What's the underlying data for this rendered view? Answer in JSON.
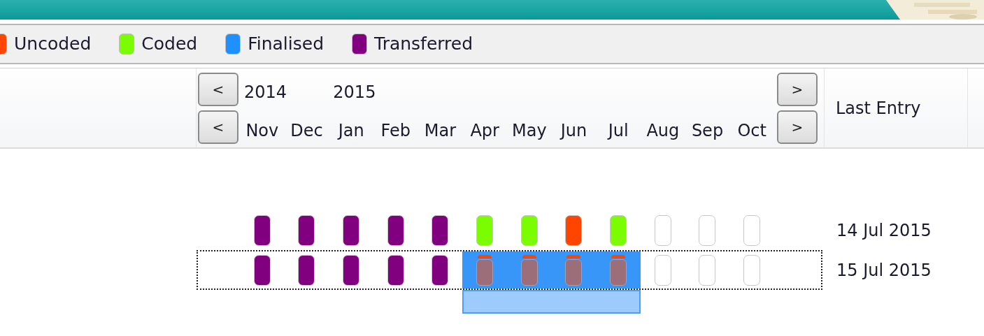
{
  "legend": [
    {
      "label": "Uncoded",
      "color": "#ff4500"
    },
    {
      "label": "Coded",
      "color": "#7cfc00"
    },
    {
      "label": "Finalised",
      "color": "#1e90ff"
    },
    {
      "label": "Transferred",
      "color": "#800080"
    }
  ],
  "timeline": {
    "prev_year_button": "<",
    "next_year_button": ">",
    "prev_month_button": "<",
    "next_month_button": ">",
    "years": [
      {
        "label": "2014",
        "months": [
          "Nov",
          "Dec"
        ]
      },
      {
        "label": "2015",
        "months": [
          "Jan",
          "Feb",
          "Mar",
          "Apr",
          "May",
          "Jun",
          "Jul",
          "Aug",
          "Sep",
          "Oct"
        ]
      }
    ],
    "last_entry_header": "Last Entry"
  },
  "rows": [
    {
      "focused": false,
      "last_entry": "14 Jul 2015",
      "cells": [
        {
          "color": "#800080",
          "selected": false
        },
        {
          "color": "#800080",
          "selected": false
        },
        {
          "color": "#800080",
          "selected": false
        },
        {
          "color": "#800080",
          "selected": false
        },
        {
          "color": "#800080",
          "selected": false
        },
        {
          "color": "#7cfc00",
          "selected": false
        },
        {
          "color": "#7cfc00",
          "selected": false
        },
        {
          "color": "#ff4500",
          "selected": false
        },
        {
          "color": "#7cfc00",
          "selected": false
        },
        {
          "color": "#ffffff",
          "selected": false
        },
        {
          "color": "#ffffff",
          "selected": false
        },
        {
          "color": "#ffffff",
          "selected": false
        }
      ]
    },
    {
      "focused": true,
      "last_entry": "15 Jul 2015",
      "cells": [
        {
          "color": "#800080",
          "selected": false
        },
        {
          "color": "#800080",
          "selected": false
        },
        {
          "color": "#800080",
          "selected": false
        },
        {
          "color": "#800080",
          "selected": false
        },
        {
          "color": "#800080",
          "selected": false
        },
        {
          "color": "#ff4500",
          "selected": true
        },
        {
          "color": "#ff4500",
          "selected": true
        },
        {
          "color": "#ff4500",
          "selected": true
        },
        {
          "color": "#ff4500",
          "selected": true
        },
        {
          "color": "#ffffff",
          "selected": false
        },
        {
          "color": "#ffffff",
          "selected": false
        },
        {
          "color": "#ffffff",
          "selected": false
        }
      ]
    }
  ]
}
